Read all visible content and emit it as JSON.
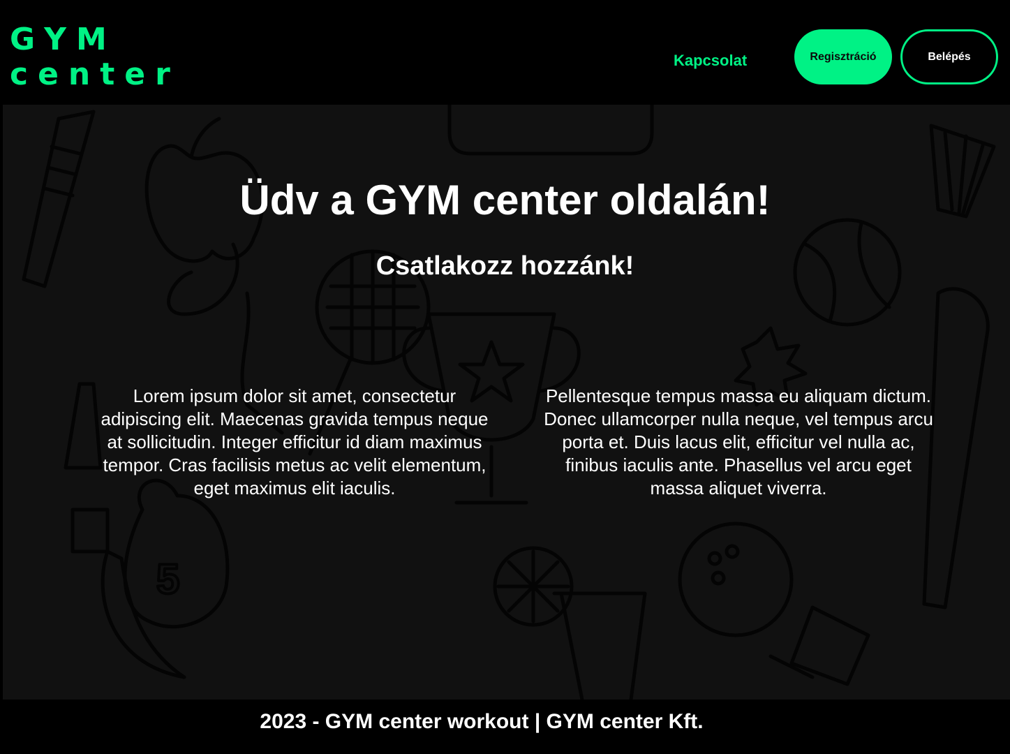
{
  "header": {
    "logo_line1": "GYM",
    "logo_line2": "center",
    "nav_contact": "Kapcsolat",
    "register_label": "Regisztráció",
    "login_label": "Belépés"
  },
  "hero": {
    "title": "Üdv a GYM center oldalán!",
    "subtitle": "Csatlakozz hozzánk!",
    "column_left": "Lorem ipsum dolor sit amet, consectetur adipiscing elit. Maecenas gravida tempus neque at sollicitudin. Integer efficitur id diam maximus tempor. Cras facilisis metus ac velit elementum, eget maximus elit iaculis.",
    "column_right": "Pellentesque tempus massa eu aliquam dictum. Donec ullamcorper nulla neque, vel tempus arcu porta et. Duis lacus elit, efficitur vel nulla ac, finibus iaculis ante. Phasellus vel arcu eget massa aliquet viverra."
  },
  "footer": {
    "text": "2023 - GYM center workout | GYM center Kft."
  },
  "colors": {
    "accent": "#00f285",
    "background": "#000000",
    "hero_background": "#111111",
    "text": "#ffffff"
  }
}
